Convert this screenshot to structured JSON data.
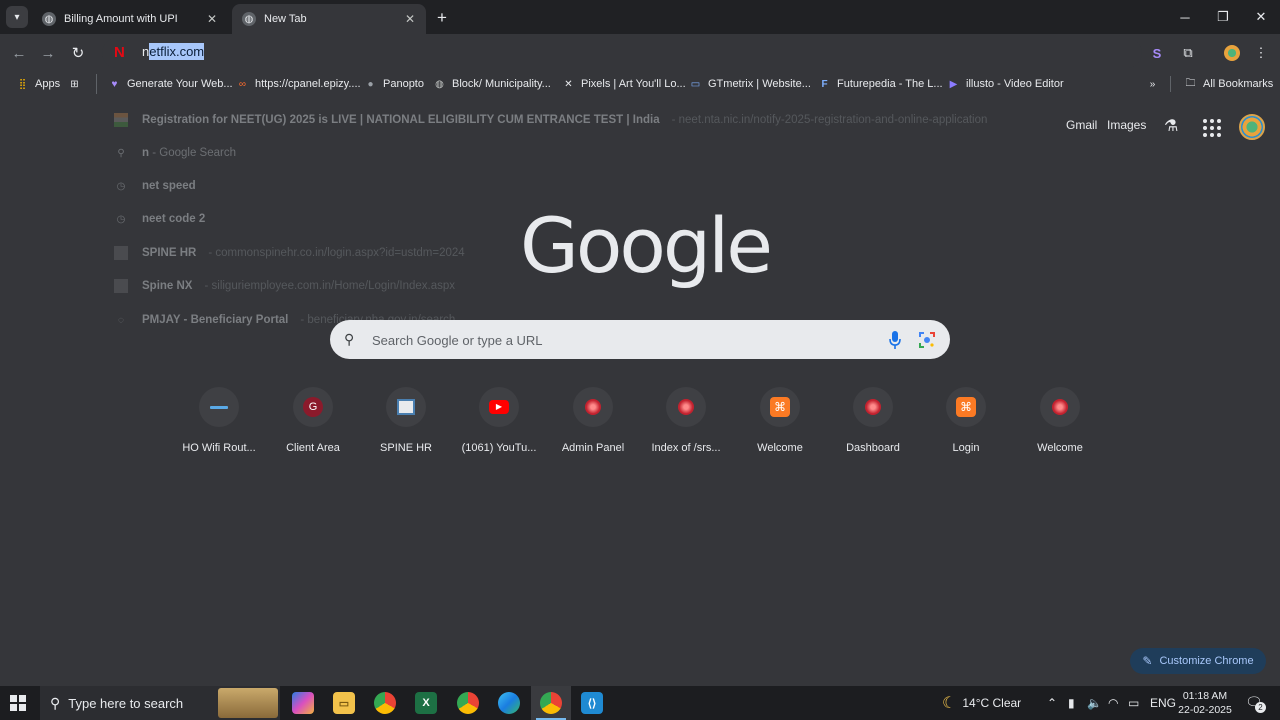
{
  "tabs": [
    {
      "title": "Billing Amount with UPI",
      "active": false
    },
    {
      "title": "New Tab",
      "active": true
    }
  ],
  "omnibox": {
    "prefix": "n",
    "selected": "etflix.com"
  },
  "bookmarks": [
    {
      "label": "Apps",
      "icon": "apps-grid-icon"
    },
    {
      "label": "Generate Your Web...",
      "icon": "heart-icon"
    },
    {
      "label": "https://cpanel.epizy....",
      "icon": "cpanel-icon"
    },
    {
      "label": "Panopto",
      "icon": "panopto-icon"
    },
    {
      "label": "Block/ Municipality...",
      "icon": "globe-icon"
    },
    {
      "label": "Pixels | Art You'll Lo...",
      "icon": "pixels-icon"
    },
    {
      "label": "GTmetrix | Website...",
      "icon": "gtmetrix-icon"
    },
    {
      "label": "Futurepedia - The L...",
      "icon": "futurepedia-icon"
    },
    {
      "label": "illusto - Video Editor",
      "icon": "illusto-icon"
    },
    {
      "label": "All Bookmarks",
      "icon": "folder-icon"
    }
  ],
  "dropdown": [
    {
      "bold": "Registration for NEET(UG) 2025 is LIVE | NATIONAL ELIGIBILITY CUM ENTRANCE TEST | India",
      "rest": "",
      "url": "- neet.nta.nic.in/notify-2025-registration-and-online-application",
      "icon": "india-flag-icon"
    },
    {
      "bold": "n",
      "rest": "- Google Search",
      "url": "",
      "icon": "search-icon"
    },
    {
      "bold": "net speed",
      "rest": "",
      "url": "",
      "icon": "history-icon"
    },
    {
      "bold": "neet code 2",
      "rest": "",
      "url": "",
      "icon": "history-icon"
    },
    {
      "bold": "SPINE HR",
      "rest": "",
      "url": "- commonspinehr.co.in/login.aspx?id=ustdm=2024",
      "icon": "spinehr-icon"
    },
    {
      "bold": "Spine NX",
      "rest": "",
      "url": "- siliguriemployee.com.in/Home/Login/Index.aspx",
      "icon": "spinenx-icon"
    },
    {
      "bold": "PMJAY - Beneficiary Portal",
      "rest": "",
      "url": "- beneficiary.nha.gov.in/search",
      "icon": "pmjay-icon"
    }
  ],
  "ntp": {
    "gmail": "Gmail",
    "images": "Images",
    "logo": "Google",
    "search_placeholder": "Search Google or type a URL"
  },
  "shortcuts": [
    {
      "label": "HO Wifi Rout...",
      "icon": "router-icon"
    },
    {
      "label": "Client Area",
      "icon": "client-area-icon"
    },
    {
      "label": "SPINE HR",
      "icon": "spinehr-icon"
    },
    {
      "label": "(1061) YouTu...",
      "icon": "youtube-icon"
    },
    {
      "label": "Admin Panel",
      "icon": "swirl-icon"
    },
    {
      "label": "Index of /srs...",
      "icon": "swirl-icon"
    },
    {
      "label": "Welcome",
      "icon": "xampp-icon"
    },
    {
      "label": "Dashboard",
      "icon": "swirl-icon"
    },
    {
      "label": "Login",
      "icon": "xampp-icon"
    },
    {
      "label": "Welcome",
      "icon": "swirl-icon"
    }
  ],
  "customize_label": "Customize Chrome",
  "taskbar": {
    "search_text": "Type here to search",
    "weather": "14°C  Clear",
    "language": "ENG",
    "time": "01:18 AM",
    "date": "22-02-2025",
    "notifications": "2"
  },
  "colors": {
    "accent": "#a8c7fa",
    "netflix": "#e50914",
    "chrome_dark": "#35363a"
  }
}
